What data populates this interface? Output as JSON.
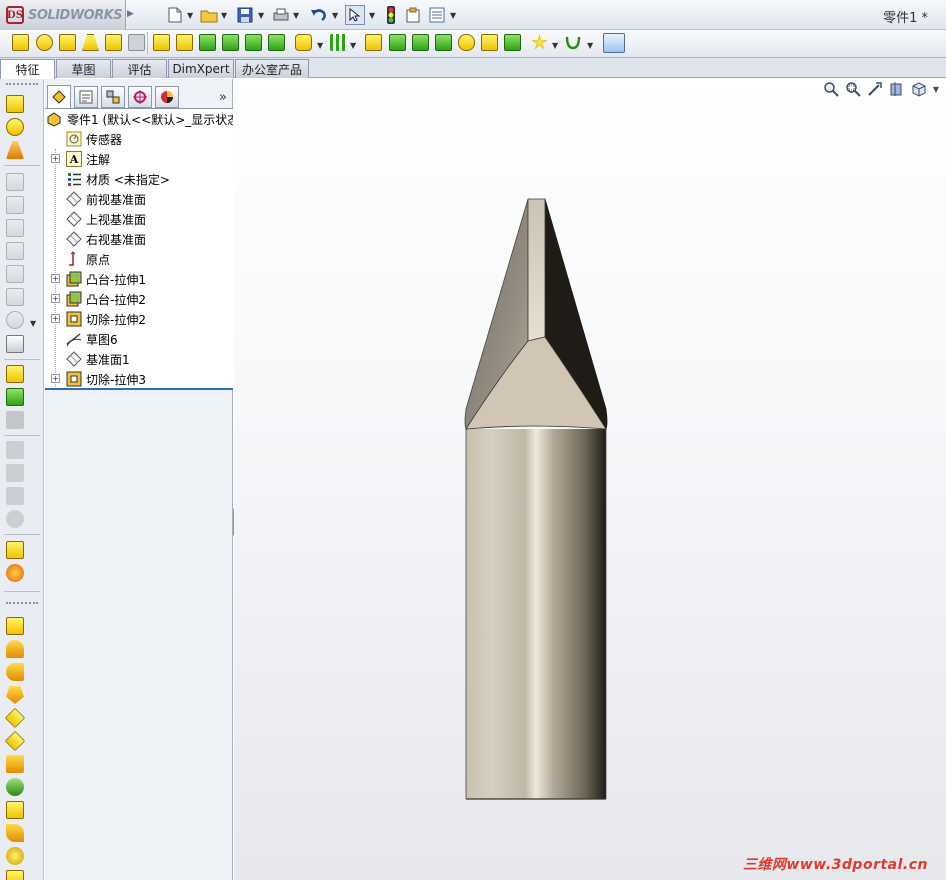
{
  "app": {
    "brand": "SOLIDWORKS",
    "logo_mark": "DS",
    "document_title": "零件1 *"
  },
  "toolbar": {
    "icons": [
      "new-document-icon",
      "open-folder-icon",
      "save-icon",
      "print-icon",
      "undo-icon",
      "select-arrow-icon",
      "rebuild-icon",
      "file-properties-icon",
      "options-icon"
    ]
  },
  "tabs": [
    {
      "label": "特征",
      "active": true
    },
    {
      "label": "草图",
      "active": false
    },
    {
      "label": "评估",
      "active": false
    },
    {
      "label": "DimXpert",
      "active": false
    },
    {
      "label": "办公室产品",
      "active": false
    }
  ],
  "feature_tree": {
    "panel_more": "»",
    "root": "零件1  (默认<<默认>_显示状态",
    "items": [
      {
        "label": "传感器",
        "icon": "sensor-icon",
        "expandable": false
      },
      {
        "label": "注解",
        "icon": "annotation-icon",
        "expandable": true
      },
      {
        "label": "材质 <未指定>",
        "icon": "material-icon",
        "expandable": false
      },
      {
        "label": "前视基准面",
        "icon": "plane-icon",
        "expandable": false
      },
      {
        "label": "上视基准面",
        "icon": "plane-icon",
        "expandable": false
      },
      {
        "label": "右视基准面",
        "icon": "plane-icon",
        "expandable": false
      },
      {
        "label": "原点",
        "icon": "origin-icon",
        "expandable": false
      },
      {
        "label": "凸台-拉伸1",
        "icon": "boss-extrude-icon",
        "expandable": true
      },
      {
        "label": "凸台-拉伸2",
        "icon": "boss-extrude-icon",
        "expandable": true
      },
      {
        "label": "切除-拉伸2",
        "icon": "cut-extrude-icon",
        "expandable": true
      },
      {
        "label": "草图6",
        "icon": "sketch-icon",
        "expandable": false
      },
      {
        "label": "基准面1",
        "icon": "plane-icon",
        "expandable": false
      },
      {
        "label": "切除-拉伸3",
        "icon": "cut-extrude-icon",
        "expandable": true
      }
    ]
  },
  "watermark": "三维网www.3dportal.cn",
  "colors": {
    "accent": "#2d6fb5",
    "tree_bg": "#ffffff",
    "panel_bg": "#eef1f6",
    "watermark": "#e23b2e"
  }
}
